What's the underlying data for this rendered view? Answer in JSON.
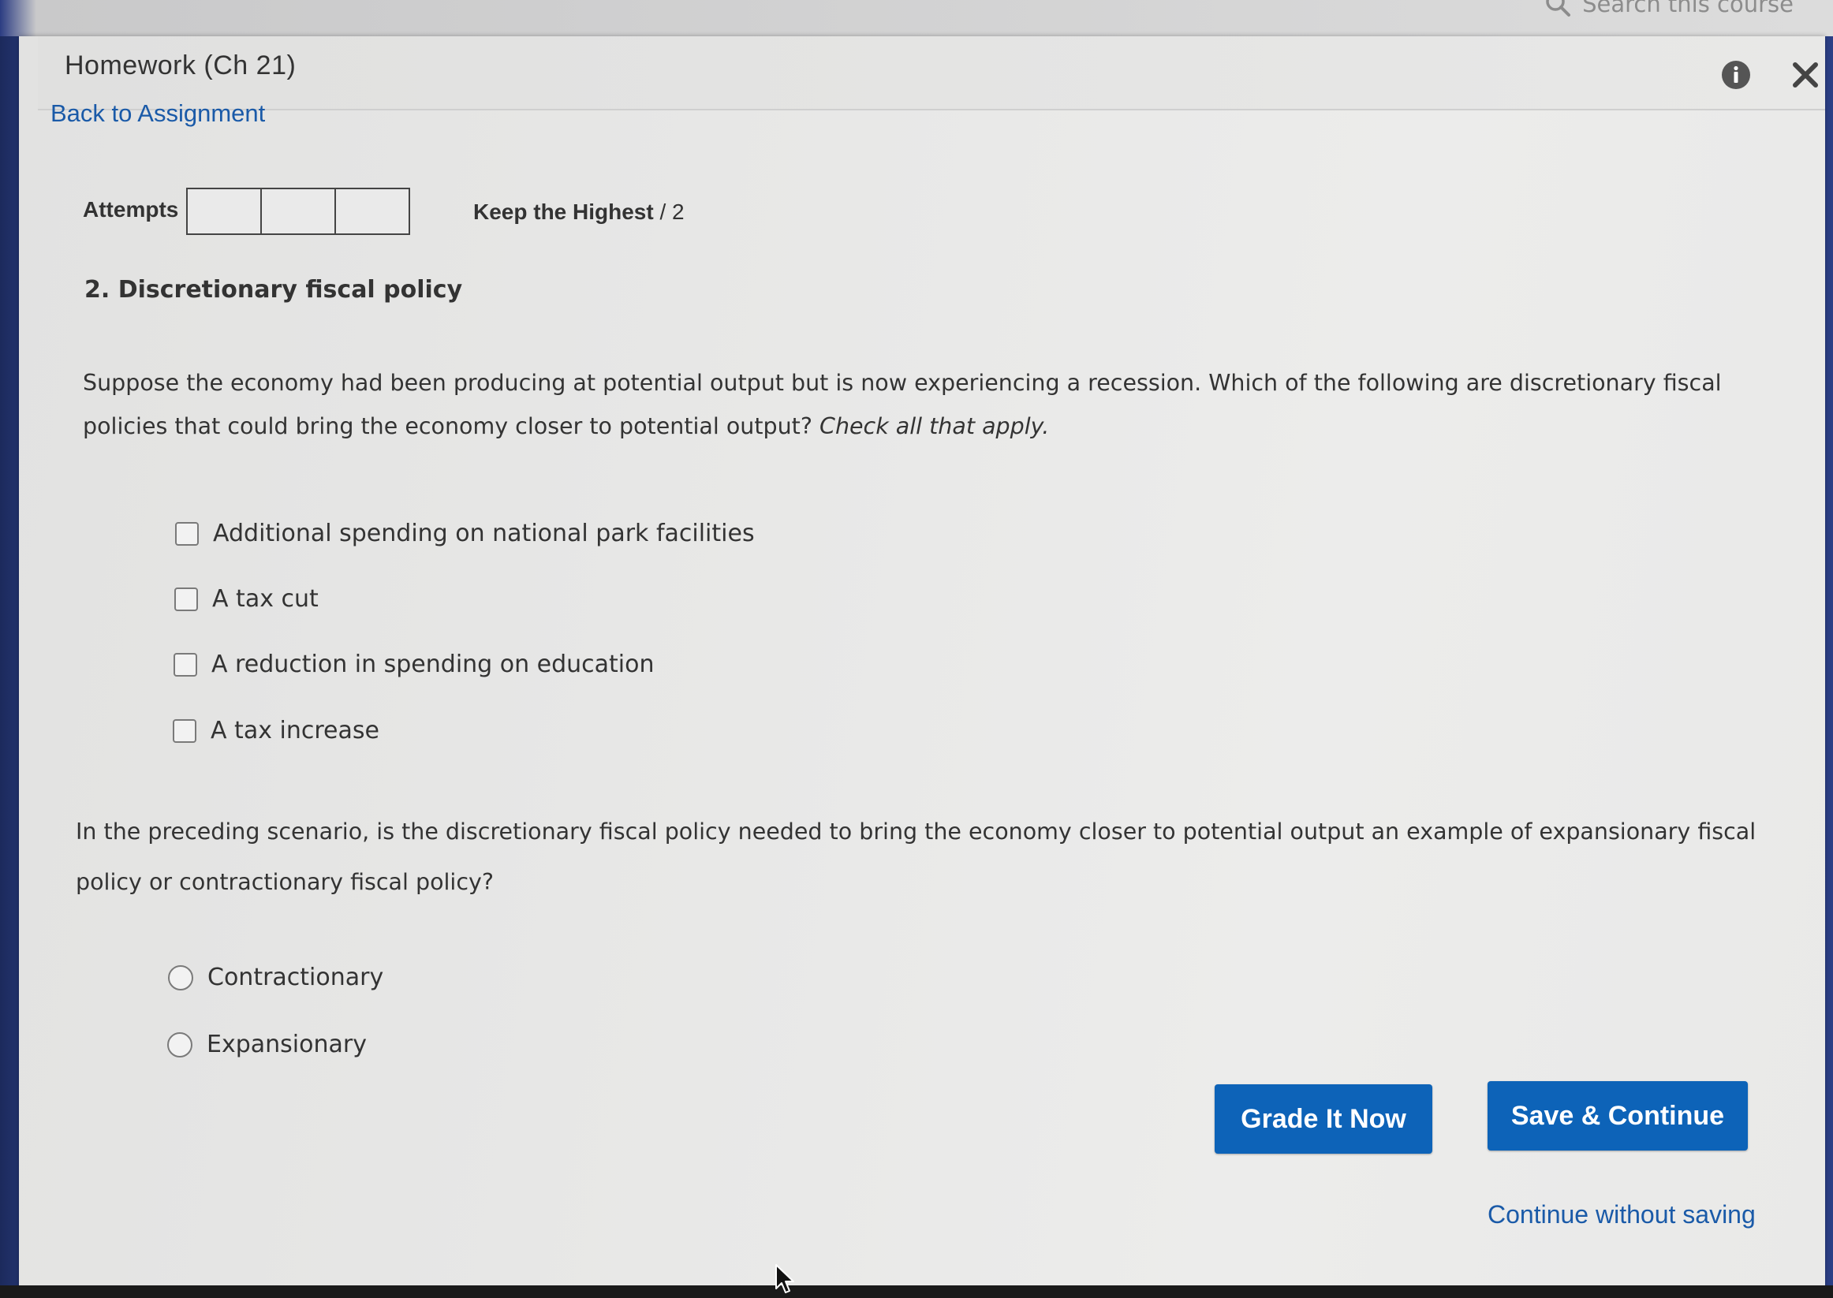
{
  "topbar": {
    "search_placeholder": "Search this course",
    "search_icon": "search-icon"
  },
  "panel": {
    "title": "Homework (Ch 21)",
    "info_icon": "info-icon",
    "close_icon": "close-icon"
  },
  "nav": {
    "back_link": "Back to Assignment"
  },
  "attempts": {
    "label": "Attempts",
    "box_count": 3,
    "keep_label": "Keep the Highest",
    "keep_value": " / 2"
  },
  "question": {
    "title": "2. Discretionary fiscal policy",
    "text": "Suppose the economy had been producing at potential output but is now experiencing a recession. Which of the following are discretionary fiscal policies that could bring the economy closer to potential output?",
    "instruction": "Check all that apply.",
    "checkbox_options": [
      {
        "label": "Additional spending on national park facilities",
        "checked": false
      },
      {
        "label": "A tax cut",
        "checked": false
      },
      {
        "label": "A reduction in spending on education",
        "checked": false
      },
      {
        "label": "A tax increase",
        "checked": false
      }
    ],
    "followup_text": "In the preceding scenario, is the discretionary fiscal policy needed to bring the economy closer to potential output an example of expansionary fiscal policy or contractionary fiscal policy?",
    "radio_options": [
      {
        "label": "Contractionary",
        "selected": false
      },
      {
        "label": "Expansionary",
        "selected": false
      }
    ]
  },
  "actions": {
    "grade_label": "Grade It Now",
    "save_label": "Save & Continue",
    "continue_label": "Continue without saving"
  },
  "colors": {
    "button_bg": "#0d63b8",
    "link": "#1a5aa8",
    "panel_bg": "#e8e8e7"
  }
}
